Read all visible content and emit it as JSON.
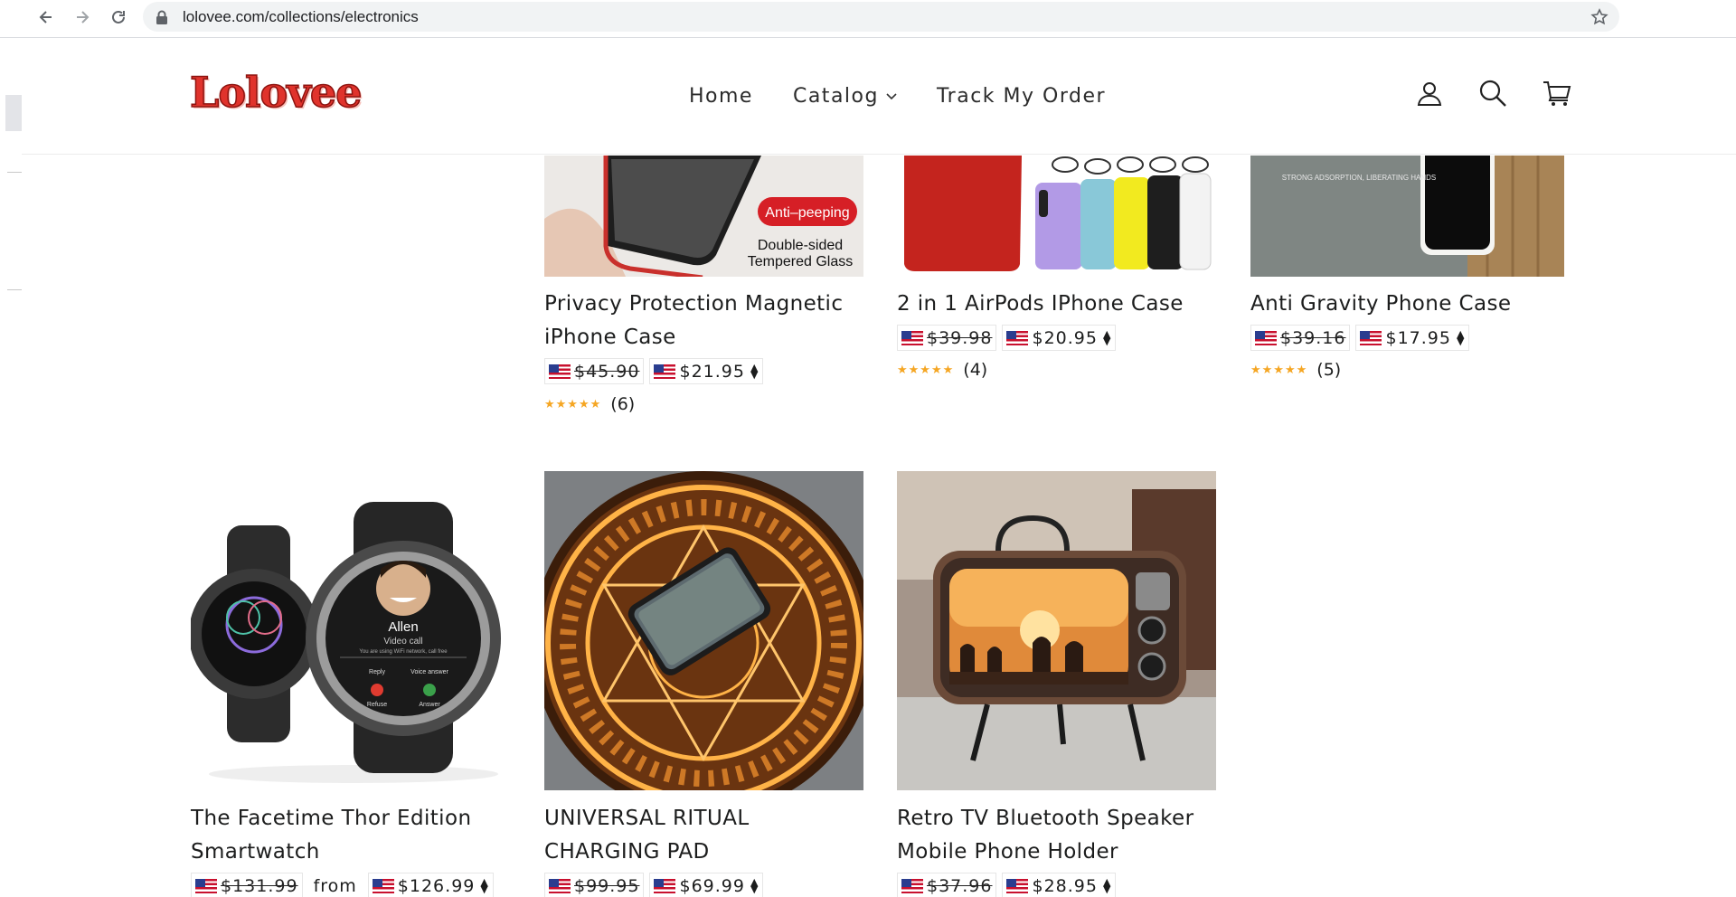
{
  "browser": {
    "url": "lolovee.com/collections/electronics",
    "icons": [
      "back-arrow-icon",
      "forward-arrow-icon",
      "reload-icon",
      "lock-icon",
      "bookmark-star-icon"
    ]
  },
  "site": {
    "logo": "Lolovee",
    "nav": {
      "home": "Home",
      "catalog": "Catalog",
      "track": "Track My Order"
    },
    "icons": [
      "account-icon",
      "search-icon",
      "cart-icon"
    ],
    "colors": {
      "logo_red": "#e0332c",
      "star_gold": "#f5a623"
    }
  },
  "products": [
    {
      "title": "Privacy Protection Magnetic iPhone Case",
      "compare_price": "$45.90",
      "price": "$21.95",
      "stars": "★★★★★",
      "reviews": "(6)",
      "image_text": [
        "Anti–peeping",
        "Double-sided",
        "Tempered Glass"
      ]
    },
    {
      "title": "2 in 1 AirPods IPhone Case",
      "compare_price": "$39.98",
      "price": "$20.95",
      "stars": "★★★★★",
      "reviews": "(4)"
    },
    {
      "title": "Anti Gravity Phone Case",
      "compare_price": "$39.16",
      "price": "$17.95",
      "stars": "★★★★★",
      "reviews": "(5)",
      "image_text": [
        "STRONG ADSORPTION, LIBERATING HANDS"
      ]
    },
    {
      "title": "The Facetime Thor Edition Smartwatch",
      "compare_price": "$131.99",
      "from_label": "from",
      "price": "$126.99",
      "image_text": [
        "Allen",
        "Video call",
        "You are using WiFi network, call free",
        "Reply",
        "Voice answer",
        "Refuse",
        "Answer"
      ]
    },
    {
      "title": "UNIVERSAL RITUAL CHARGING PAD",
      "compare_price": "$99.95",
      "price": "$69.99"
    },
    {
      "title": "Retro TV Bluetooth Speaker Mobile Phone Holder",
      "compare_price": "$37.96",
      "price": "$28.95"
    }
  ]
}
